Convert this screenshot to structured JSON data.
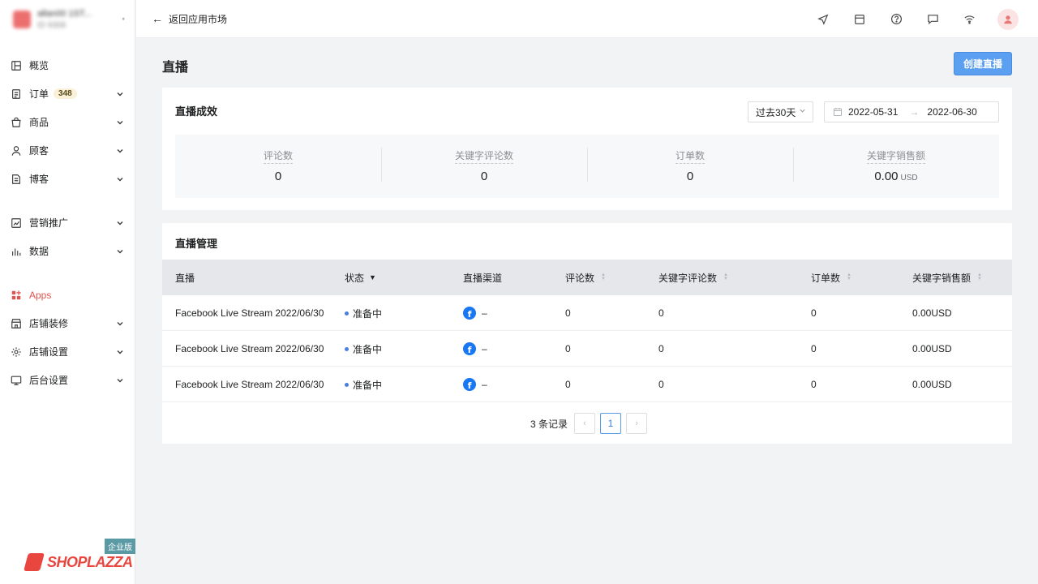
{
  "store": {
    "name": "allan00 1ST...",
    "sub": "ID 9308"
  },
  "nav": {
    "items": [
      {
        "key": "overview",
        "label": "概览",
        "icon": "dashboard-icon",
        "chevron": false
      },
      {
        "key": "orders",
        "label": "订单",
        "icon": "orders-icon",
        "chevron": true,
        "badge": "348"
      },
      {
        "key": "products",
        "label": "商品",
        "icon": "products-icon",
        "chevron": true
      },
      {
        "key": "customers",
        "label": "顾客",
        "icon": "customers-icon",
        "chevron": true
      },
      {
        "key": "blog",
        "label": "博客",
        "icon": "blog-icon",
        "chevron": true
      },
      {
        "key": "marketing",
        "label": "营销推广",
        "icon": "marketing-icon",
        "chevron": true
      },
      {
        "key": "analytics",
        "label": "数据",
        "icon": "analytics-icon",
        "chevron": true
      },
      {
        "key": "apps",
        "label": "Apps",
        "icon": "apps-icon",
        "chevron": false
      },
      {
        "key": "design",
        "label": "店铺装修",
        "icon": "store-design-icon",
        "chevron": true
      },
      {
        "key": "store-settings",
        "label": "店铺设置",
        "icon": "settings-gear-icon",
        "chevron": true
      },
      {
        "key": "admin-settings",
        "label": "后台设置",
        "icon": "monitor-icon",
        "chevron": true
      }
    ]
  },
  "brand": {
    "edition": "企业版",
    "name": "SHOPLAZZA"
  },
  "topbar": {
    "back_label": "返回应用市场"
  },
  "page": {
    "title": "直播",
    "create_button": "创建直播"
  },
  "performance": {
    "title": "直播成效",
    "range": "过去30天",
    "date_start": "2022-05-31",
    "date_end": "2022-06-30",
    "stats": [
      {
        "label": "评论数",
        "value": "0",
        "unit": ""
      },
      {
        "label": "关键字评论数",
        "value": "0",
        "unit": ""
      },
      {
        "label": "订单数",
        "value": "0",
        "unit": ""
      },
      {
        "label": "关键字销售额",
        "value": "0.00",
        "unit": "USD"
      }
    ]
  },
  "management": {
    "title": "直播管理",
    "columns": {
      "stream": "直播",
      "status": "状态",
      "channel": "直播渠道",
      "comments": "评论数",
      "keyword_comments": "关键字评论数",
      "orders": "订单数",
      "keyword_sales": "关键字销售额"
    },
    "rows": [
      {
        "stream": "Facebook Live Stream 2022/06/30",
        "status": "准备中",
        "channel": "–",
        "comments": "0",
        "keyword_comments": "0",
        "orders": "0",
        "keyword_sales": "0.00USD"
      },
      {
        "stream": "Facebook Live Stream 2022/06/30",
        "status": "准备中",
        "channel": "–",
        "comments": "0",
        "keyword_comments": "0",
        "orders": "0",
        "keyword_sales": "0.00USD"
      },
      {
        "stream": "Facebook Live Stream 2022/06/30",
        "status": "准备中",
        "channel": "–",
        "comments": "0",
        "keyword_comments": "0",
        "orders": "0",
        "keyword_sales": "0.00USD"
      }
    ],
    "pagination": {
      "total": "3 条记录",
      "current": "1"
    }
  },
  "colors": {
    "accent": "#5b9ff0",
    "brand": "#e8463f",
    "apps": "#e3534e",
    "status_dot": "#4a7fe6",
    "facebook": "#1877f2"
  }
}
